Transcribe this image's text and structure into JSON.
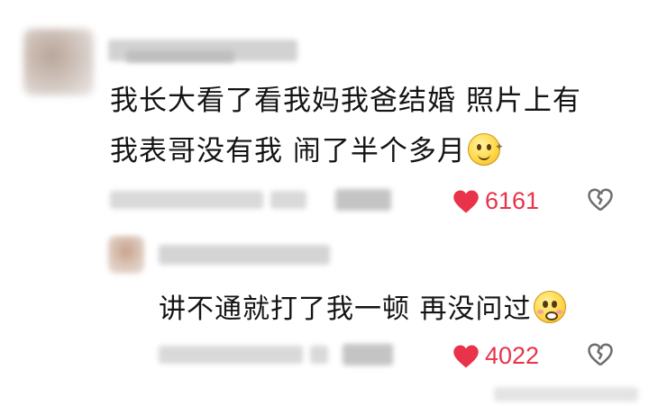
{
  "comments": [
    {
      "text_line1": "我长大看了看我妈我爸结婚 照片上有",
      "text_line2": "我表哥没有我 闹了半个多月",
      "emoji": "smiling-face-icon",
      "likes": "6161"
    },
    {
      "text": "讲不通就打了我一顿 再没问过",
      "emoji": "pleading-face-icon",
      "likes": "4022"
    }
  ],
  "colors": {
    "like_red": "#e8334a",
    "dislike_gray": "#6e6e6e",
    "blur_gray": "#d6d6d6"
  }
}
